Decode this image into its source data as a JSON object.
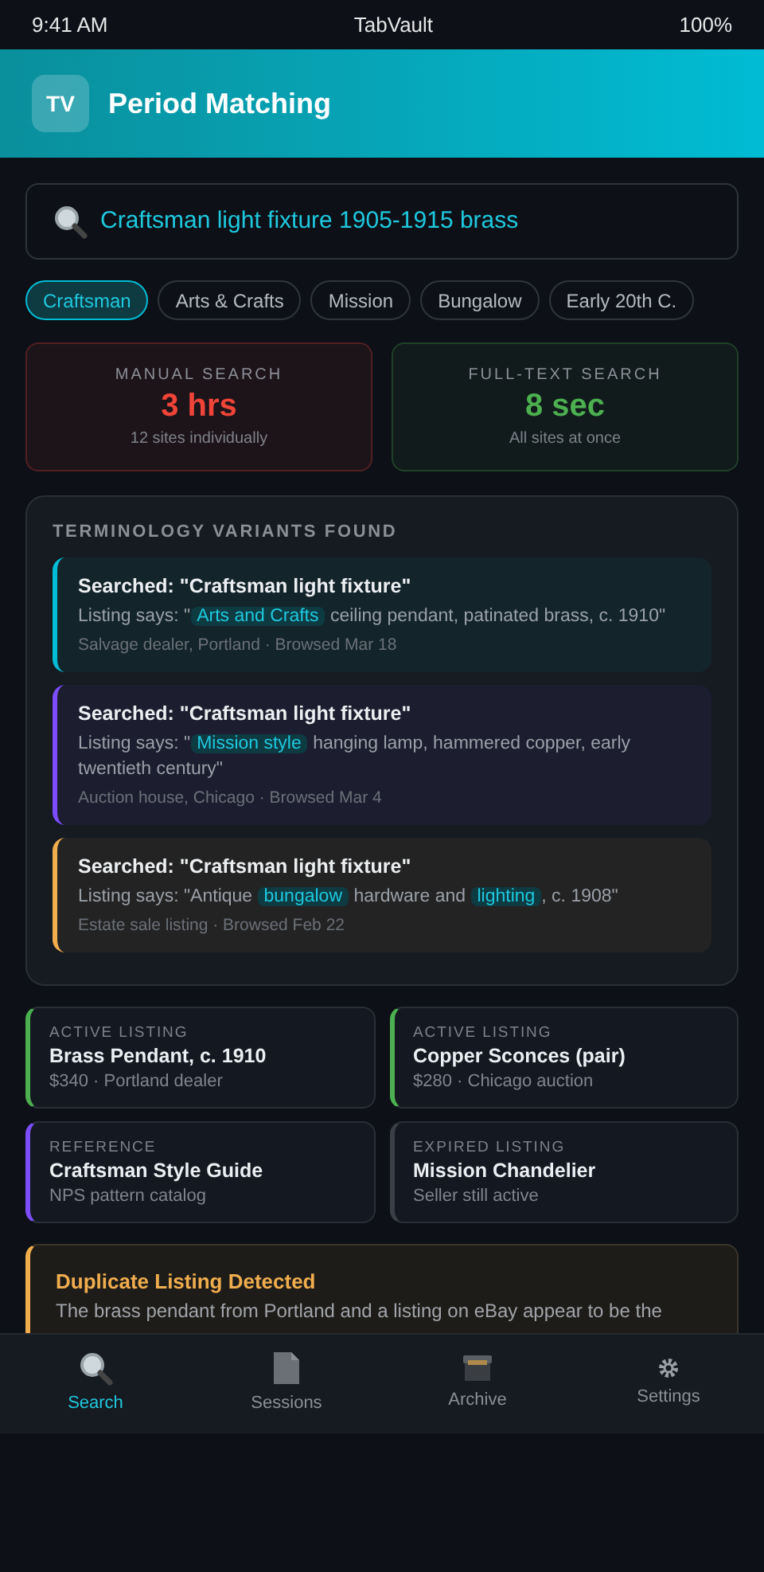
{
  "status_bar": {
    "time": "9:41 AM",
    "carrier": "TabVault",
    "battery": "100%"
  },
  "header": {
    "logo": "TV",
    "title": "Period Matching"
  },
  "search": {
    "value": "Craftsman light fixture 1905-1915 brass"
  },
  "chips": [
    {
      "label": "Craftsman",
      "selected": true
    },
    {
      "label": "Arts & Crafts",
      "selected": false
    },
    {
      "label": "Mission",
      "selected": false
    },
    {
      "label": "Bungalow",
      "selected": false
    },
    {
      "label": "Early 20th C.",
      "selected": false
    }
  ],
  "stats": [
    {
      "label": "MANUAL SEARCH",
      "value": "3 hrs",
      "note": "12 sites individually",
      "color": "#f04438"
    },
    {
      "label": "FULL-TEXT SEARCH",
      "value": "8 sec",
      "note": "All sites at once",
      "color": "#4caf50"
    }
  ],
  "variants": {
    "title": "TERMINOLOGY VARIANTS FOUND",
    "items": [
      {
        "searched": "Searched: \"Craftsman light fixture\"",
        "listing": "Listing says: \"**Arts and Crafts** ceiling pendant, patinated brass, c. 1910\"",
        "source": "Salvage dealer, Portland · Browsed Mar 18",
        "color": "#00bcd4"
      },
      {
        "searched": "Searched: \"Craftsman light fixture\"",
        "listing": "Listing says: \"**Mission style** hanging lamp, hammered copper, early twentieth century\"",
        "source": "Auction house, Chicago · Browsed Mar 4",
        "color": "#7c4dff"
      },
      {
        "searched": "Searched: \"Craftsman light fixture\"",
        "listing": "Listing says: \"Antique **bungalow** hardware and **lighting**, c. 1908\"",
        "source": "Estate sale listing · Browsed Feb 22",
        "color": "#f0ad4e"
      }
    ]
  },
  "listings": [
    {
      "status": "ACTIVE LISTING",
      "title": "Brass Pendant, c. 1910",
      "detail": "$340 · Portland dealer",
      "color": "#4caf50"
    },
    {
      "status": "ACTIVE LISTING",
      "title": "Copper Sconces (pair)",
      "detail": "$280 · Chicago auction",
      "color": "#4caf50"
    },
    {
      "status": "REFERENCE",
      "title": "Craftsman Style Guide",
      "detail": "NPS pattern catalog",
      "color": "#7c4dff"
    },
    {
      "status": "EXPIRED LISTING",
      "title": "Mission Chandelier",
      "detail": "Seller still active",
      "color": "#3a3f47"
    }
  ],
  "alert": {
    "title": "Duplicate Listing Detected",
    "text": "The brass pendant from Portland and a listing on eBay appear to be the"
  },
  "nav": [
    {
      "label": "Search",
      "kind": "search",
      "selected": true
    },
    {
      "label": "Sessions",
      "kind": "document",
      "selected": false
    },
    {
      "label": "Archive",
      "kind": "archive",
      "selected": false
    },
    {
      "label": "Settings",
      "kind": "settings",
      "selected": false
    }
  ]
}
